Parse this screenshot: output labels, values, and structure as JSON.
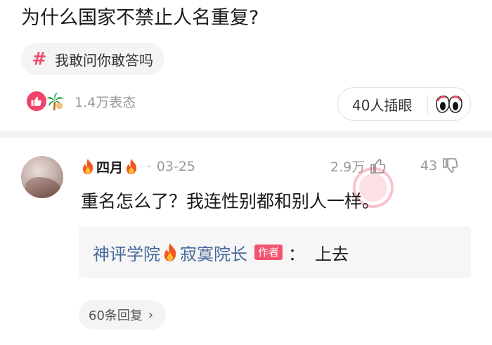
{
  "post": {
    "title": "为什么国家不禁止人名重复?",
    "topic": {
      "icon": "hash-icon",
      "label": "我敢问你敢答吗"
    },
    "reactions": {
      "count_text": "1.4万表态",
      "icons": [
        "thumbs-up-icon",
        "palm-tree-icon"
      ]
    },
    "peek": {
      "label": "40人插眼",
      "icon": "eyes-icon"
    }
  },
  "comment": {
    "username": "四月",
    "date": "03-25",
    "likes": "2.9万",
    "dislikes": "43",
    "text": "重名怎么了？我连性别都和别人一样。",
    "reply": {
      "author": "神评学院",
      "author_suffix": "寂寞院长",
      "badge": "作者",
      "colon": "：",
      "text": "上去"
    },
    "replies_button": "60条回复"
  },
  "colors": {
    "accent_pink": "#f3436a",
    "link_blue": "#44689a",
    "muted_gray": "#9a9a9a",
    "badge_red": "#f2536f"
  }
}
